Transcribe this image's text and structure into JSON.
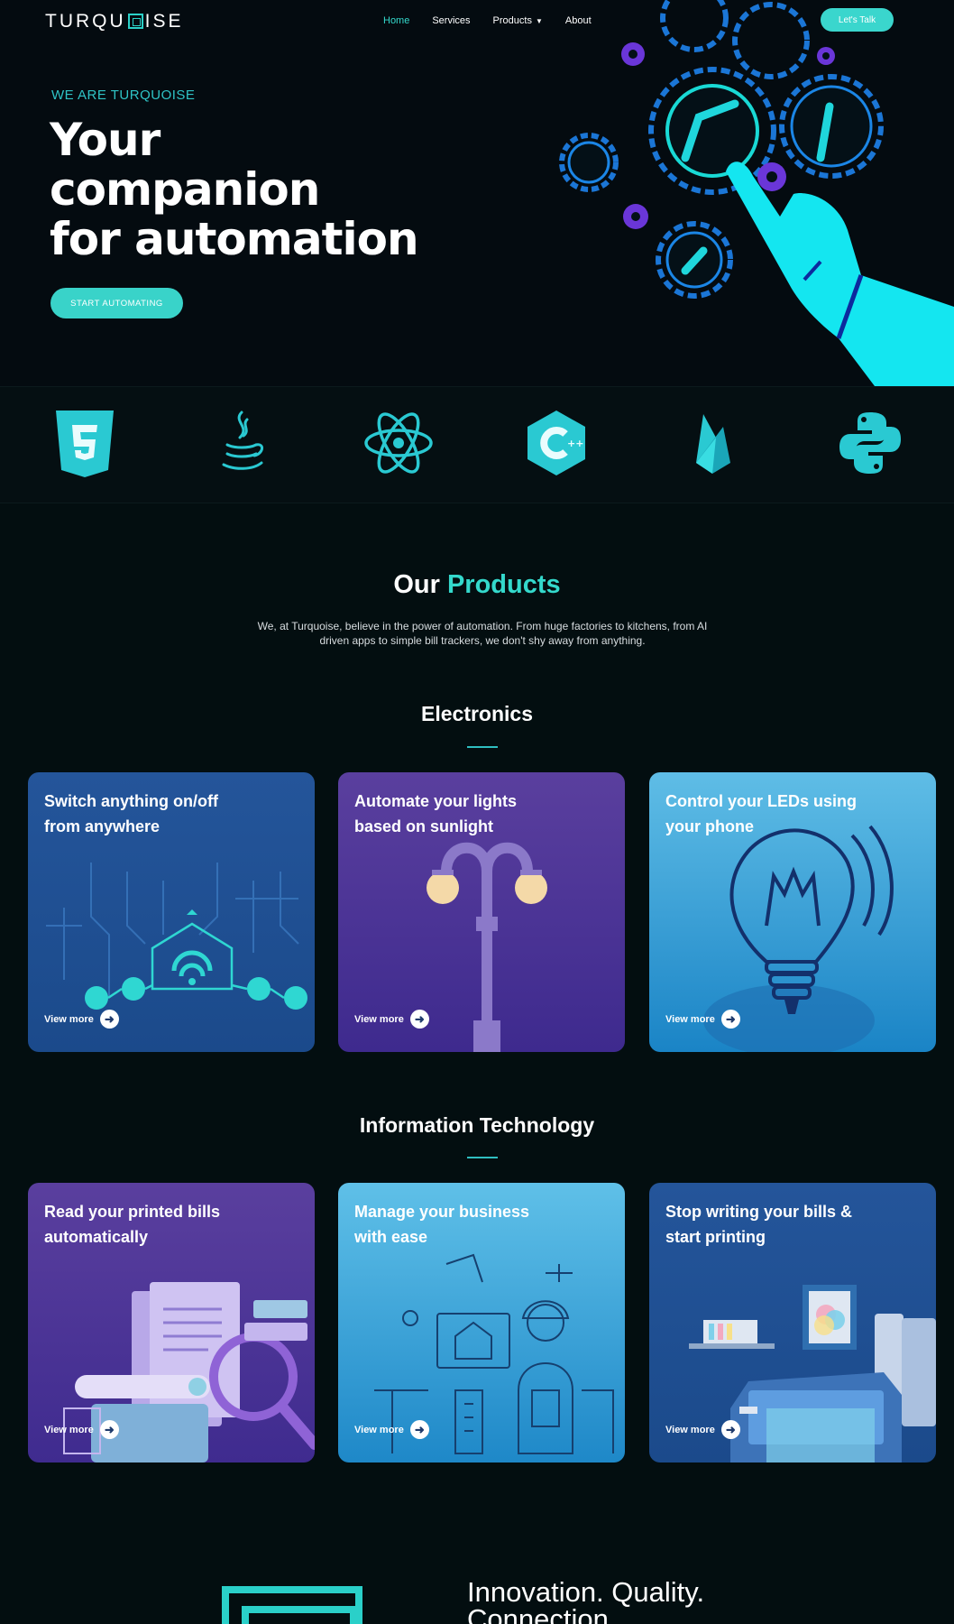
{
  "nav": {
    "logo": "TURQUOISE",
    "items": [
      "Home",
      "Services",
      "Products",
      "About"
    ],
    "cta": "Let's Talk"
  },
  "hero": {
    "eyebrow": "WE ARE TURQUOISE",
    "headline_1": "Your",
    "headline_2": "companion",
    "headline_3": "for automation",
    "cta": "START AUTOMATING"
  },
  "tech_icons": [
    "html5-icon",
    "java-icon",
    "react-icon",
    "cplusplus-icon",
    "firebase-icon",
    "python-icon"
  ],
  "products": {
    "title_plain": "Our",
    "title_accent": "Products",
    "description": "We, at Turquoise, believe in the power of automation. From huge factories to kitchens, from AI driven apps to simple bill trackers, we don't shy away from anything."
  },
  "electronics": {
    "title": "Electronics",
    "cards": [
      {
        "title": "Switch anything on/off from anywhere",
        "link": "View more"
      },
      {
        "title": "Automate your lights based on sunlight",
        "link": "View more"
      },
      {
        "title": "Control your LEDs using your phone",
        "link": "View more"
      }
    ]
  },
  "it": {
    "title": "Information Technology",
    "cards": [
      {
        "title": "Read your printed bills automatically",
        "link": "View more"
      },
      {
        "title": "Manage your business with ease",
        "link": "View more"
      },
      {
        "title": "Stop writing your bills & start printing",
        "link": "View more"
      }
    ]
  },
  "tagline": {
    "line1": "Innovation. Quality.",
    "line2": "Connection."
  },
  "colors": {
    "accent": "#34d9cc",
    "background": "#030e10"
  }
}
